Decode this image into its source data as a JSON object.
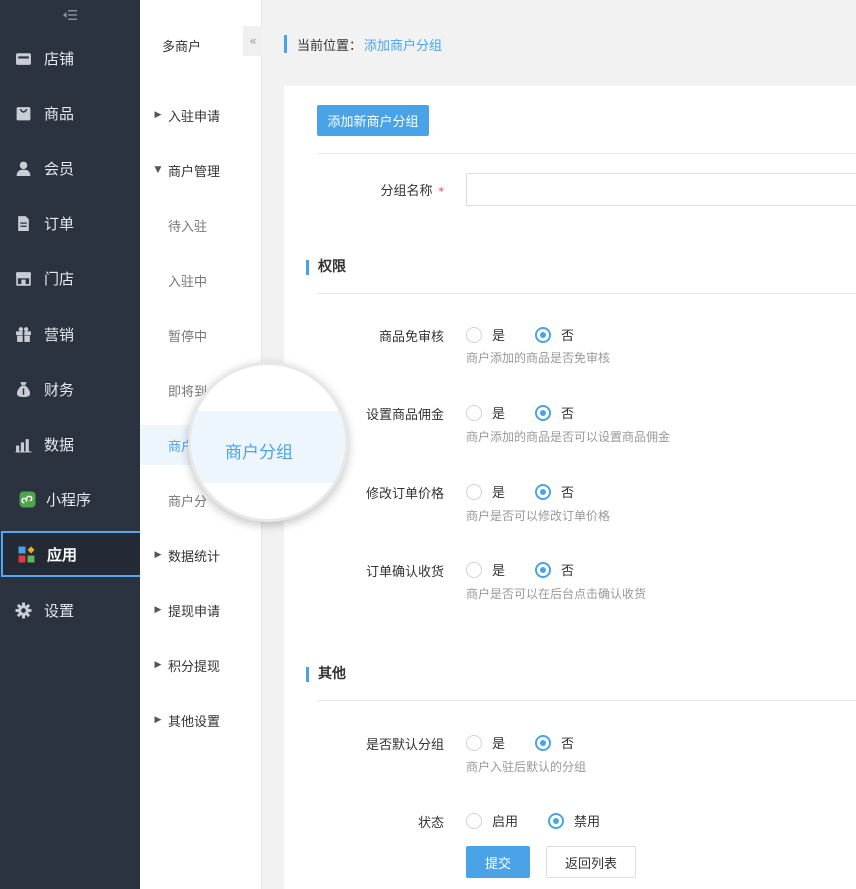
{
  "sidebar": {
    "toggle_icon": "collapse-icon",
    "items": [
      {
        "label": "店铺",
        "icon": "store-icon"
      },
      {
        "label": "商品",
        "icon": "bag-icon"
      },
      {
        "label": "会员",
        "icon": "user-icon"
      },
      {
        "label": "订单",
        "icon": "document-icon"
      },
      {
        "label": "门店",
        "icon": "shop-icon"
      },
      {
        "label": "营销",
        "icon": "gift-icon"
      },
      {
        "label": "财务",
        "icon": "money-bag-icon"
      },
      {
        "label": "数据",
        "icon": "bar-chart-icon"
      },
      {
        "label": "小程序",
        "icon": "miniprogram-icon"
      },
      {
        "label": "应用",
        "icon": "apps-grid-icon",
        "active": true
      },
      {
        "label": "设置",
        "icon": "gear-icon"
      }
    ],
    "active_border_color": "#55a6f0"
  },
  "subnav": {
    "title": "多商户",
    "collapse_label": "«",
    "items": [
      {
        "label": "入驻申请",
        "expanded": false
      },
      {
        "label": "商户管理",
        "expanded": true
      },
      {
        "label": "待入驻",
        "child": true
      },
      {
        "label": "入驻中",
        "child": true
      },
      {
        "label": "暂停中",
        "child": true
      },
      {
        "label": "即将到",
        "child": true
      },
      {
        "label": "商户",
        "child": true,
        "selected": true
      },
      {
        "label": "商户分",
        "child": true
      },
      {
        "label": "数据统计",
        "expanded": false
      },
      {
        "label": "提现申请",
        "expanded": false
      },
      {
        "label": "积分提现",
        "expanded": false
      },
      {
        "label": "其他设置",
        "expanded": false
      }
    ]
  },
  "breadcrumb": {
    "label": "当前位置：",
    "current": "添加商户分组"
  },
  "toolbar": {
    "add_button": "添加新商户分组"
  },
  "form": {
    "group_name": {
      "label": "分组名称",
      "required_mark": "*",
      "value": ""
    },
    "section_permissions": "权限",
    "permissions": [
      {
        "label": "商品免审核",
        "options": [
          "是",
          "否"
        ],
        "selected": "否",
        "hint": "商户添加的商品是否免审核"
      },
      {
        "label": "设置商品佣金",
        "options": [
          "是",
          "否"
        ],
        "selected": "否",
        "hint": "商户添加的商品是否可以设置商品佣金"
      },
      {
        "label": "修改订单价格",
        "options": [
          "是",
          "否"
        ],
        "selected": "否",
        "hint": "商户是否可以修改订单价格"
      },
      {
        "label": "订单确认收货",
        "options": [
          "是",
          "否"
        ],
        "selected": "否",
        "hint": "商户是否可以在后台点击确认收货"
      }
    ],
    "section_other": "其他",
    "default_group": {
      "label": "是否默认分组",
      "options": [
        "是",
        "否"
      ],
      "selected": "否",
      "hint": "商户入驻后默认的分组"
    },
    "status": {
      "label": "状态",
      "options": [
        "启用",
        "禁用"
      ],
      "selected": "禁用"
    },
    "submit_label": "提交",
    "back_label": "返回列表"
  },
  "magnifier": {
    "text": "商户分组"
  },
  "colors": {
    "accent": "#4aa3e6",
    "sidebar_bg": "#2b3340",
    "required": "#e4393c"
  }
}
